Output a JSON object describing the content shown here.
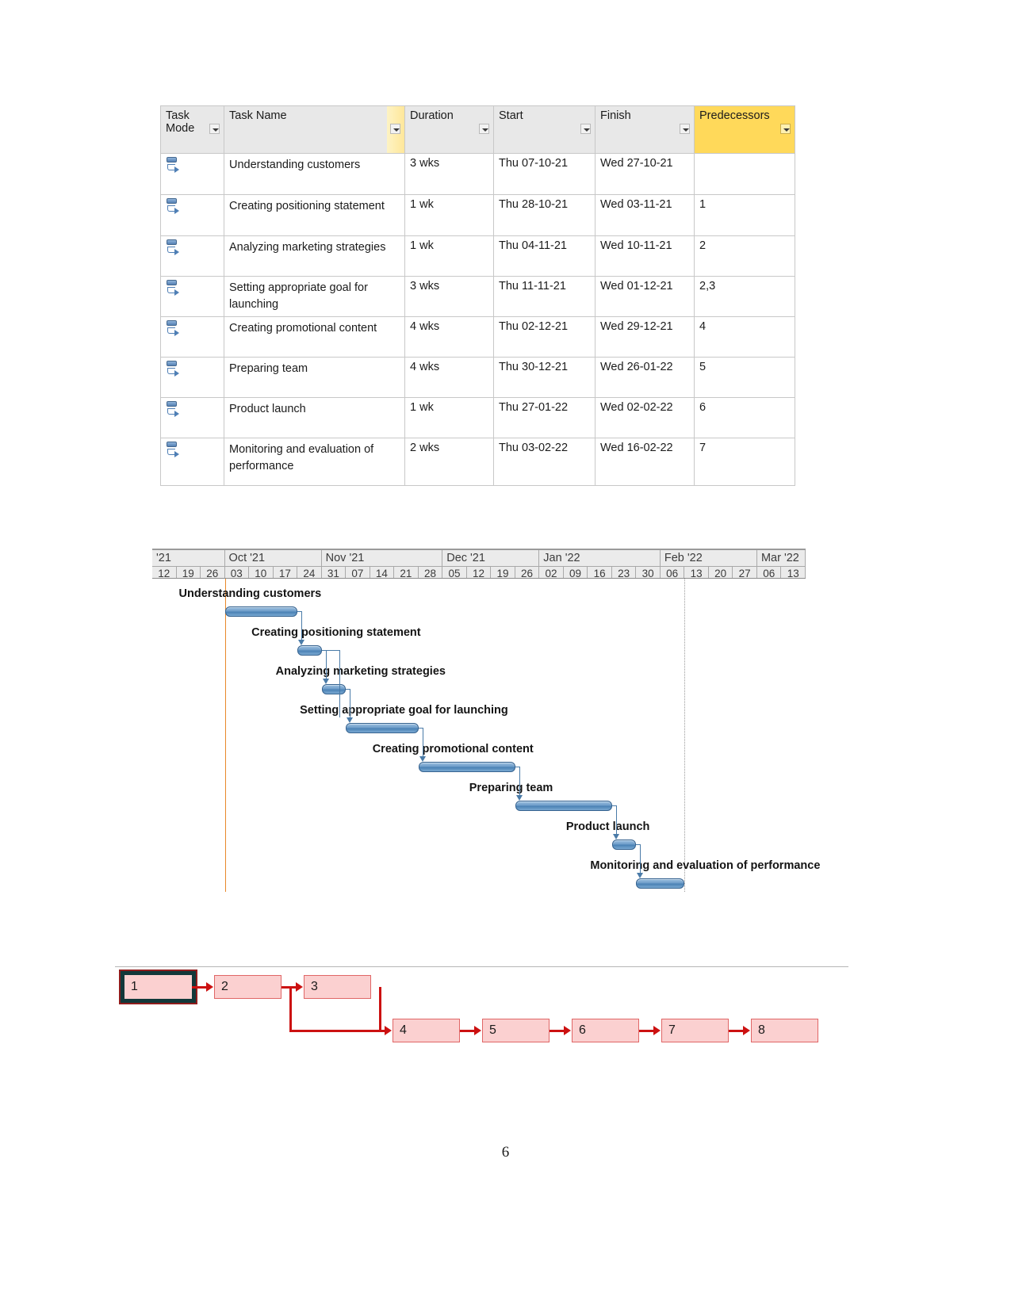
{
  "page": {
    "number": "6"
  },
  "task_table": {
    "columns": [
      {
        "key": "task_mode",
        "label": "Task Mode"
      },
      {
        "key": "task_name",
        "label": "Task Name"
      },
      {
        "key": "duration",
        "label": "Duration"
      },
      {
        "key": "start",
        "label": "Start"
      },
      {
        "key": "finish",
        "label": "Finish"
      },
      {
        "key": "predecessors",
        "label": "Predecessors"
      }
    ],
    "header_highlight_color": "#ffd95a",
    "rows": [
      {
        "id": 1,
        "task_name": "Understanding customers",
        "duration": "3 wks",
        "start": "Thu 07-10-21",
        "finish": "Wed 27-10-21",
        "predecessors": ""
      },
      {
        "id": 2,
        "task_name": "Creating positioning statement",
        "duration": "1 wk",
        "start": "Thu 28-10-21",
        "finish": "Wed 03-11-21",
        "predecessors": "1"
      },
      {
        "id": 3,
        "task_name": "Analyzing marketing strategies",
        "duration": "1 wk",
        "start": "Thu 04-11-21",
        "finish": "Wed 10-11-21",
        "predecessors": "2"
      },
      {
        "id": 4,
        "task_name": "Setting appropriate goal for launching",
        "duration": "3 wks",
        "start": "Thu 11-11-21",
        "finish": "Wed 01-12-21",
        "predecessors": "2,3"
      },
      {
        "id": 5,
        "task_name": "Creating promotional content",
        "duration": "4 wks",
        "start": "Thu 02-12-21",
        "finish": "Wed 29-12-21",
        "predecessors": "4"
      },
      {
        "id": 6,
        "task_name": "Preparing team",
        "duration": "4 wks",
        "start": "Thu 30-12-21",
        "finish": "Wed 26-01-22",
        "predecessors": "5"
      },
      {
        "id": 7,
        "task_name": "Product launch",
        "duration": "1 wk",
        "start": "Thu 27-01-22",
        "finish": "Wed 02-02-22",
        "predecessors": "6"
      },
      {
        "id": 8,
        "task_name": "Monitoring and evaluation of performance",
        "duration": "2 wks",
        "start": "Thu 03-02-22",
        "finish": "Wed 16-02-22",
        "predecessors": "7"
      }
    ]
  },
  "chart_data": {
    "type": "bar",
    "title": "Gantt Chart",
    "orientation": "horizontal-timeline",
    "xlabel": "",
    "ylabel": "",
    "timeline_months": [
      {
        "label": "'21",
        "weeks": [
          "12",
          "19",
          "26"
        ]
      },
      {
        "label": "Oct '21",
        "weeks": [
          "03",
          "10",
          "17",
          "24"
        ]
      },
      {
        "label": "Nov '21",
        "weeks": [
          "31",
          "07",
          "14",
          "21",
          "28"
        ]
      },
      {
        "label": "Dec '21",
        "weeks": [
          "05",
          "12",
          "19",
          "26"
        ]
      },
      {
        "label": "Jan '22",
        "weeks": [
          "02",
          "09",
          "16",
          "23",
          "30"
        ]
      },
      {
        "label": "Feb '22",
        "weeks": [
          "06",
          "13",
          "20",
          "27"
        ]
      },
      {
        "label": "Mar '22",
        "weeks": [
          "06",
          "13"
        ]
      }
    ],
    "week_ticks": [
      "12",
      "19",
      "26",
      "03",
      "10",
      "17",
      "24",
      "31",
      "07",
      "14",
      "21",
      "28",
      "05",
      "12",
      "19",
      "26",
      "02",
      "09",
      "16",
      "23",
      "30",
      "06",
      "13",
      "20",
      "27",
      "06",
      "13"
    ],
    "bar_color": "#5b8dc0",
    "today_line_color": "#e8882a",
    "tasks": [
      {
        "id": 1,
        "label": "Understanding customers",
        "start": "Thu 07-10-21",
        "finish": "Wed 27-10-21",
        "duration_weeks": 3,
        "start_week_index": 3,
        "predecessors": []
      },
      {
        "id": 2,
        "label": "Creating positioning statement",
        "start": "Thu 28-10-21",
        "finish": "Wed 03-11-21",
        "duration_weeks": 1,
        "start_week_index": 6,
        "predecessors": [
          1
        ]
      },
      {
        "id": 3,
        "label": "Analyzing marketing strategies",
        "start": "Thu 04-11-21",
        "finish": "Wed 10-11-21",
        "duration_weeks": 1,
        "start_week_index": 7,
        "predecessors": [
          2
        ]
      },
      {
        "id": 4,
        "label": "Setting appropriate goal for launching",
        "start": "Thu 11-11-21",
        "finish": "Wed 01-12-21",
        "duration_weeks": 3,
        "start_week_index": 8,
        "predecessors": [
          2,
          3
        ]
      },
      {
        "id": 5,
        "label": "Creating promotional content",
        "start": "Thu 02-12-21",
        "finish": "Wed 29-12-21",
        "duration_weeks": 4,
        "start_week_index": 11,
        "predecessors": [
          4
        ]
      },
      {
        "id": 6,
        "label": "Preparing team",
        "start": "Thu 30-12-21",
        "finish": "Wed 26-01-22",
        "duration_weeks": 4,
        "start_week_index": 15,
        "predecessors": [
          5
        ]
      },
      {
        "id": 7,
        "label": "Product launch",
        "start": "Thu 27-01-22",
        "finish": "Wed 02-02-22",
        "duration_weeks": 1,
        "start_week_index": 19,
        "predecessors": [
          6
        ]
      },
      {
        "id": 8,
        "label": "Monitoring and evaluation of performance",
        "start": "Thu 03-02-22",
        "finish": "Wed 16-02-22",
        "duration_weeks": 2,
        "start_week_index": 20,
        "predecessors": [
          7
        ]
      }
    ]
  },
  "network_diagram": {
    "node_fill": "#fbd0d0",
    "node_border": "#e06666",
    "edge_color": "#cc1111",
    "start_node_frame": "#12383a",
    "nodes": [
      {
        "id": "n1",
        "label": "1",
        "is_start": true
      },
      {
        "id": "n2",
        "label": "2",
        "is_start": false
      },
      {
        "id": "n3",
        "label": "3",
        "is_start": false
      },
      {
        "id": "n4",
        "label": "4",
        "is_start": false
      },
      {
        "id": "n5",
        "label": "5",
        "is_start": false
      },
      {
        "id": "n6",
        "label": "6",
        "is_start": false
      },
      {
        "id": "n7",
        "label": "7",
        "is_start": false
      },
      {
        "id": "n8",
        "label": "8",
        "is_start": false
      }
    ],
    "edges": [
      {
        "from": "n1",
        "to": "n2"
      },
      {
        "from": "n2",
        "to": "n3"
      },
      {
        "from": "n2",
        "to": "n4"
      },
      {
        "from": "n3",
        "to": "n4"
      },
      {
        "from": "n4",
        "to": "n5"
      },
      {
        "from": "n5",
        "to": "n6"
      },
      {
        "from": "n6",
        "to": "n7"
      },
      {
        "from": "n7",
        "to": "n8"
      }
    ]
  }
}
